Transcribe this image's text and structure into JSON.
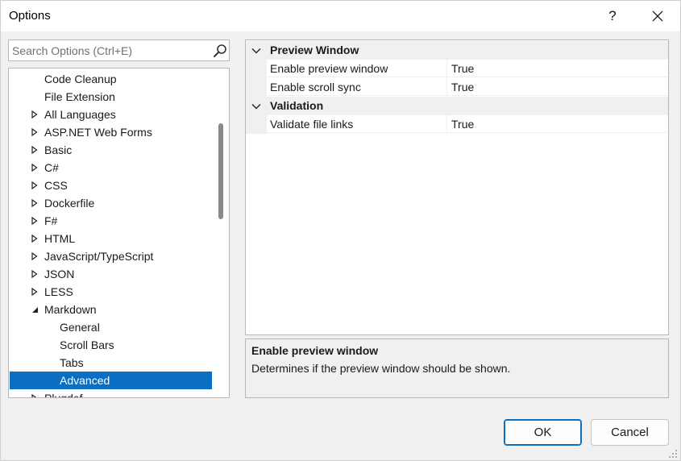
{
  "window": {
    "title": "Options"
  },
  "titlebar": {
    "help_glyph": "?",
    "close_glyph": "✕"
  },
  "search": {
    "placeholder": "Search Options (Ctrl+E)",
    "value": ""
  },
  "tree": {
    "items": [
      {
        "label": "Code Cleanup",
        "level": 1,
        "arrow": "none"
      },
      {
        "label": "File Extension",
        "level": 1,
        "arrow": "none"
      },
      {
        "label": "All Languages",
        "level": 1,
        "arrow": "collapsed"
      },
      {
        "label": "ASP.NET Web Forms",
        "level": 1,
        "arrow": "collapsed"
      },
      {
        "label": "Basic",
        "level": 1,
        "arrow": "collapsed"
      },
      {
        "label": "C#",
        "level": 1,
        "arrow": "collapsed"
      },
      {
        "label": "CSS",
        "level": 1,
        "arrow": "collapsed"
      },
      {
        "label": "Dockerfile",
        "level": 1,
        "arrow": "collapsed"
      },
      {
        "label": "F#",
        "level": 1,
        "arrow": "collapsed"
      },
      {
        "label": "HTML",
        "level": 1,
        "arrow": "collapsed"
      },
      {
        "label": "JavaScript/TypeScript",
        "level": 1,
        "arrow": "collapsed"
      },
      {
        "label": "JSON",
        "level": 1,
        "arrow": "collapsed"
      },
      {
        "label": "LESS",
        "level": 1,
        "arrow": "collapsed"
      },
      {
        "label": "Markdown",
        "level": 1,
        "arrow": "expanded"
      },
      {
        "label": "General",
        "level": 2,
        "arrow": "none"
      },
      {
        "label": "Scroll Bars",
        "level": 2,
        "arrow": "none"
      },
      {
        "label": "Tabs",
        "level": 2,
        "arrow": "none"
      },
      {
        "label": "Advanced",
        "level": 2,
        "arrow": "none",
        "selected": true
      },
      {
        "label": "Plugdef",
        "level": 1,
        "arrow": "collapsed"
      }
    ]
  },
  "grid": {
    "categories": [
      {
        "label": "Preview Window",
        "properties": [
          {
            "name": "Enable preview window",
            "value": "True"
          },
          {
            "name": "Enable scroll sync",
            "value": "True"
          }
        ]
      },
      {
        "label": "Validation",
        "properties": [
          {
            "name": "Validate file links",
            "value": "True"
          }
        ]
      }
    ]
  },
  "description": {
    "title": "Enable preview window",
    "text": "Determines if the preview window should be shown."
  },
  "buttons": {
    "ok": "OK",
    "cancel": "Cancel"
  },
  "colors": {
    "selection": "#0a6fc2",
    "panel": "#f0f0f0"
  },
  "icons": {
    "search": "search-icon",
    "close": "close-icon",
    "help": "help-icon"
  }
}
